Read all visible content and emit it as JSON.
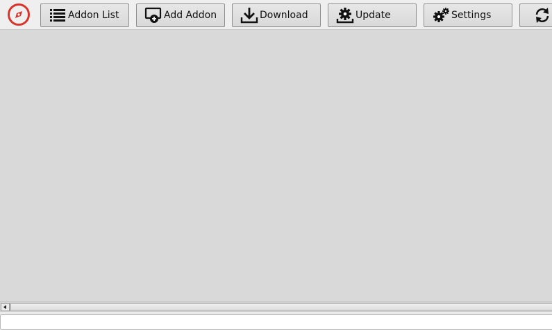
{
  "toolbar": {
    "logo_icon": "compass-icon",
    "buttons": [
      {
        "label": "Addon List",
        "icon": "list-icon"
      },
      {
        "label": "Add Addon",
        "icon": "add-monitor-icon"
      },
      {
        "label": "Download",
        "icon": "download-icon"
      },
      {
        "label": "Update",
        "icon": "update-gear-icon"
      },
      {
        "label": "Settings",
        "icon": "gears-icon"
      },
      {
        "label": "",
        "icon": "refresh-icon"
      }
    ]
  },
  "status": {
    "text": ""
  },
  "colors": {
    "logo_red": "#d9342b",
    "background": "#d9d9d9",
    "toolbar": "#efefef"
  }
}
